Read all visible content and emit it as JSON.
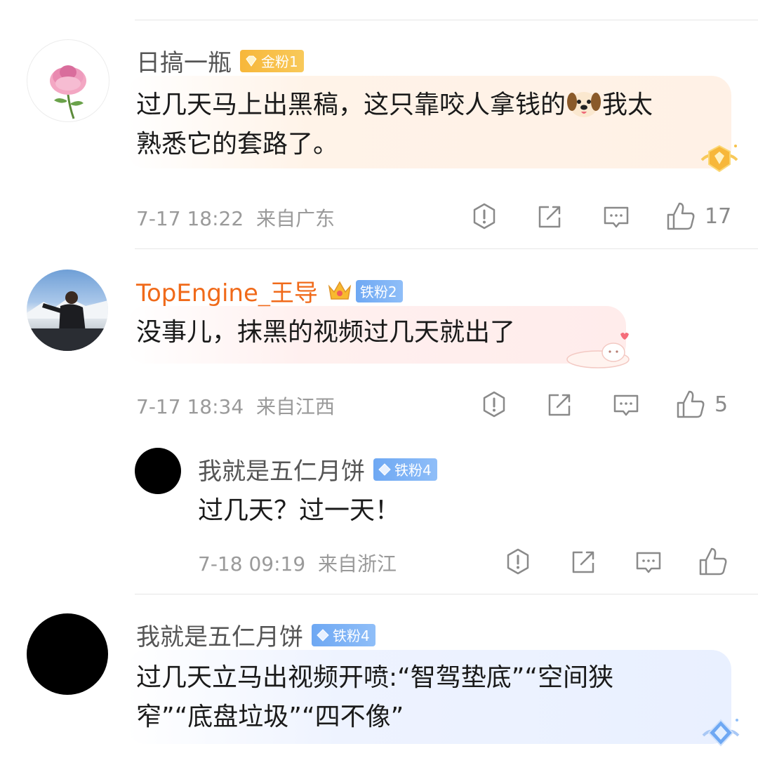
{
  "comments": [
    {
      "username": "日搞一瓶",
      "badge": "金粉1",
      "text_line1": "过几天马上出黑稿，这只靠咬人拿钱的",
      "text_line1_after": "我太",
      "text_line2": "熟悉它的套路了。",
      "time": "7-17 18:22",
      "location": "来自广东",
      "likes": "17",
      "avatar_icon": "peony-flower-icon",
      "emoji_icon": "dog-face-emoji"
    },
    {
      "username": "TopEngine_王导",
      "badge": "铁粉2",
      "text": "没事儿，抹黑的视频过几天就出了",
      "time": "7-17 18:34",
      "location": "来自江西",
      "likes": "5",
      "username_color": "#f06a1a"
    },
    {
      "username": "我就是五仁月饼",
      "badge": "铁粉4",
      "text": "过几天？过一天！",
      "time": "7-18 09:19",
      "location": "来自浙江"
    },
    {
      "username": "我就是五仁月饼",
      "badge": "铁粉4",
      "text_line1": "过几天立马出视频开喷:“智驾垫底”“空间狭",
      "text_line2": "窄”“底盘垃圾”“四不像”"
    }
  ],
  "colors": {
    "gold_badge": "#f7b73a",
    "iron_badge": "#6ea8f3",
    "meta_text": "#9a9a9a",
    "highlight_name": "#f06a1a"
  }
}
